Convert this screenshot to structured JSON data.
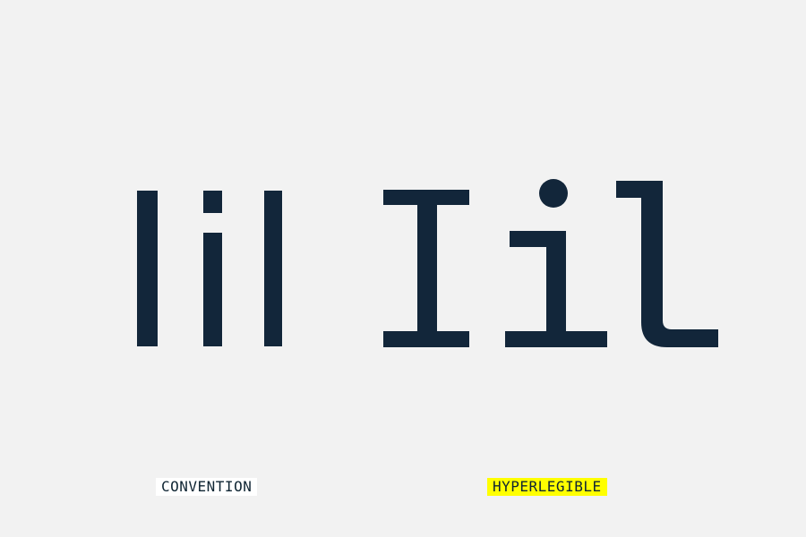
{
  "colors": {
    "background": "#f2f2f2",
    "glyph": "#12263a",
    "label_text": "#0f2533",
    "conventional_label_bg": "#ffffff",
    "hyperlegible_label_bg": "#ffff00"
  },
  "conventional": {
    "label": "CONVENTION"
  },
  "hyperlegible": {
    "label": "HYPERLEGIBLE"
  }
}
